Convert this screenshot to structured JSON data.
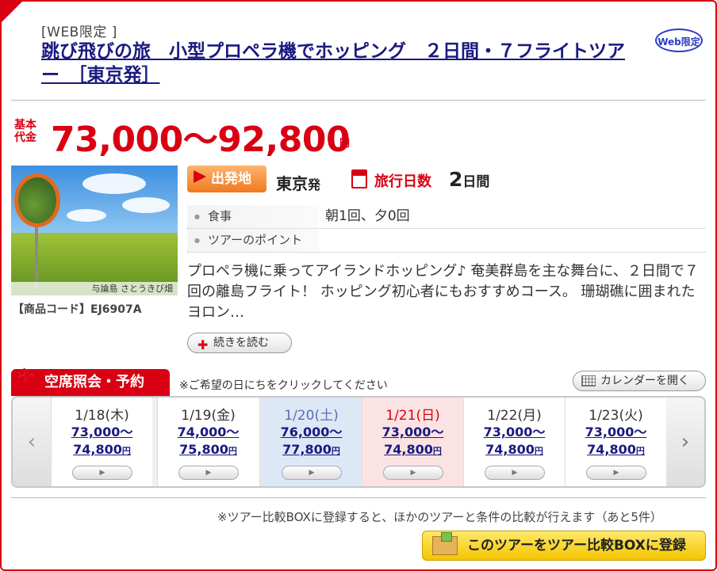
{
  "header": {
    "web_tag": "[WEB限定 ]",
    "title": "跳び飛びの旅　小型プロペラ機でホッピング　２日間・７フライトツアー　［東京発］",
    "web_badge": "Web限定"
  },
  "price": {
    "label": "基本代金",
    "range": "73,000〜92,800",
    "unit": "円"
  },
  "photo": {
    "caption": "与論島 さとうきび畑"
  },
  "product_code": "【商品コード】EJ6907A",
  "departure": {
    "label": "出発地",
    "value": "東京",
    "suffix": "発"
  },
  "duration": {
    "label": "旅行日数",
    "value": "2",
    "unit": "日間"
  },
  "info": {
    "meal_label": "食事",
    "meal_value": "朝1回、夕0回",
    "point_label": "ツアーのポイント"
  },
  "description": "プロペラ機に乗ってアイランドホッピング♪ 奄美群島を主な舞台に、２日間で７回の離島フライト！ ホッピング初心者にもおすすめコース。 珊瑚礁に囲まれたヨロン…",
  "more_button": "続きを読む",
  "reservation": {
    "tab_label": "空席照会・予約",
    "note": "※ご希望の日にちをクリックしてください",
    "calendar_button": "カレンダーを開く",
    "prev_arrow": "‹",
    "next_arrow": "›",
    "play_glyph": "▶",
    "days": [
      {
        "date": "1/18(木)",
        "from": "73,000〜",
        "to": "74,800",
        "unit": "円"
      },
      {
        "date": "1/19(金)",
        "from": "74,000〜",
        "to": "75,800",
        "unit": "円"
      },
      {
        "date": "1/20(土)",
        "from": "76,000〜",
        "to": "77,800",
        "unit": "円"
      },
      {
        "date": "1/21(日)",
        "from": "73,000〜",
        "to": "74,800",
        "unit": "円"
      },
      {
        "date": "1/22(月)",
        "from": "73,000〜",
        "to": "74,800",
        "unit": "円"
      },
      {
        "date": "1/23(火)",
        "from": "73,000〜",
        "to": "74,800",
        "unit": "円"
      }
    ]
  },
  "compare": {
    "note": "※ツアー比較BOXに登録すると、ほかのツアーと条件の比較が行えます（あと5件）",
    "button": "このツアーをツアー比較BOXに登録"
  },
  "colors": {
    "brand_red": "#d80012",
    "link_navy": "#1a1a80",
    "saturday_bg": "#dde8f7",
    "sunday_bg": "#fbe3e3",
    "compare_yellow": "#f3c400"
  }
}
